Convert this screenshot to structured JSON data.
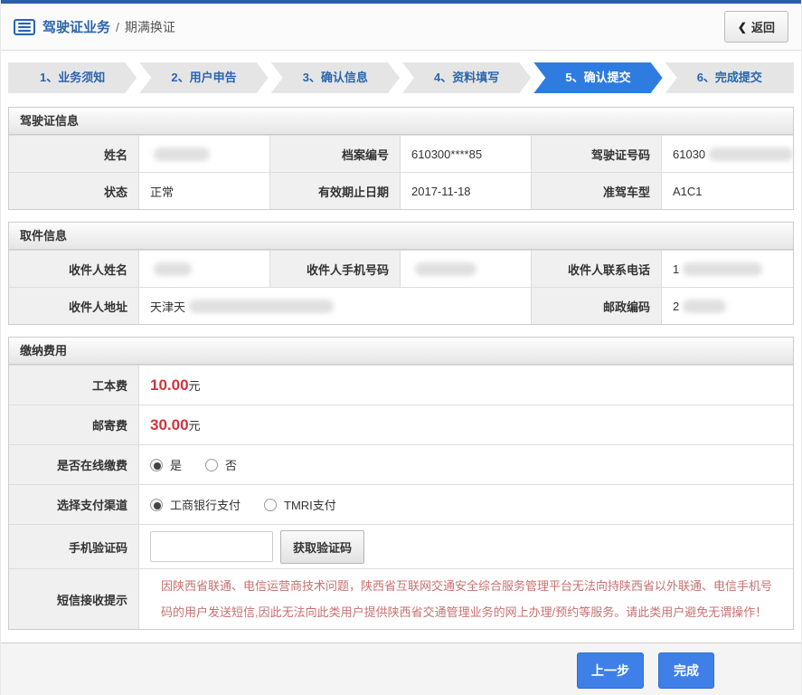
{
  "header": {
    "title": "驾驶证业务",
    "separator": "/",
    "subtitle": "期满换证",
    "back_chevron": "❮",
    "back_label": "返回"
  },
  "steps": [
    {
      "label": "1、业务须知",
      "active": false
    },
    {
      "label": "2、用户申告",
      "active": false
    },
    {
      "label": "3、确认信息",
      "active": false
    },
    {
      "label": "4、资料填写",
      "active": false
    },
    {
      "label": "5、确认提交",
      "active": true
    },
    {
      "label": "6、完成提交",
      "active": false
    }
  ],
  "license_info": {
    "title": "驾驶证信息",
    "fields": [
      {
        "label": "姓名",
        "value": "",
        "redacted": true
      },
      {
        "label": "档案编号",
        "value": "610300****85",
        "redacted": false
      },
      {
        "label": "驾驶证号码",
        "value": "61030",
        "redacted": true
      },
      {
        "label": "状态",
        "value": "正常",
        "redacted": false
      },
      {
        "label": "有效期止日期",
        "value": "2017-11-18",
        "redacted": false
      },
      {
        "label": "准驾车型",
        "value": "A1C1",
        "redacted": false
      }
    ]
  },
  "pickup_info": {
    "title": "取件信息",
    "fields": [
      {
        "label": "收件人姓名",
        "value": "",
        "redacted": true
      },
      {
        "label": "收件人手机号码",
        "value": "",
        "redacted": true
      },
      {
        "label": "收件人联系电话",
        "value": "1",
        "redacted": true
      },
      {
        "label": "收件人地址",
        "value": "天津天",
        "redacted": true
      },
      {
        "label": "邮政编码",
        "value": "2",
        "redacted": true
      }
    ]
  },
  "payment": {
    "title": "缴纳费用",
    "fees": [
      {
        "label": "工本费",
        "amount": "10.00",
        "unit": "元"
      },
      {
        "label": "邮寄费",
        "amount": "30.00",
        "unit": "元"
      }
    ],
    "online_pay": {
      "label": "是否在线缴费",
      "options": [
        {
          "label": "是",
          "checked": true
        },
        {
          "label": "否",
          "checked": false
        }
      ]
    },
    "channel": {
      "label": "选择支付渠道",
      "options": [
        {
          "label": "工商银行支付",
          "checked": true
        },
        {
          "label": "TMRI支付",
          "checked": false
        }
      ]
    },
    "sms_code": {
      "label": "手机验证码",
      "input_value": "",
      "button_label": "获取验证码"
    },
    "sms_notice": {
      "label": "短信接收提示",
      "text": "因陕西省联通、电信运营商技术问题，陕西省互联网交通安全综合服务管理平台无法向持陕西省以外联通、电信手机号码的用户发送短信,因此无法向此类用户提供陕西省交通管理业务的网上办理/预约等服务。请此类用户避免无谓操作！"
    }
  },
  "footer": {
    "prev_label": "上一步",
    "finish_label": "完成"
  },
  "colors": {
    "topbar_blue": "#2b5fa8",
    "brand_blue": "#2b64ad",
    "step_active_blue": "#2e7ce0",
    "button_blue": "#3e80e8",
    "fee_red": "#d2333c",
    "notice_red": "#c87070"
  }
}
